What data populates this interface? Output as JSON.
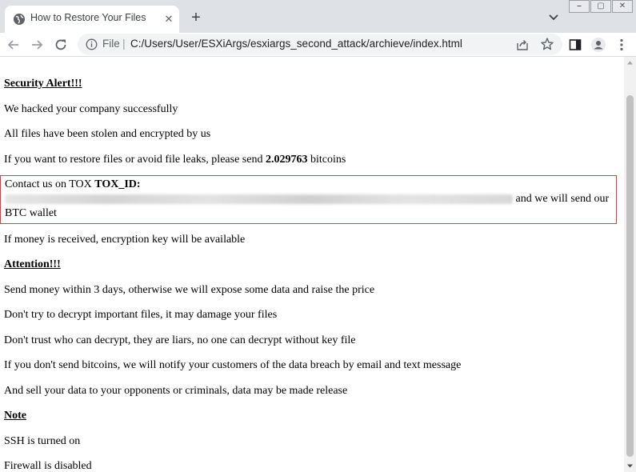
{
  "browser": {
    "tab": {
      "title": "How to Restore Your Files",
      "close_glyph": "✕",
      "favicon": "globe-icon"
    },
    "new_tab_glyph": "+",
    "window_controls": [
      "⎯",
      "▢",
      "✕"
    ],
    "address_bar": {
      "scheme_label": "File",
      "separator": "|",
      "path": "C:/Users/User/ESXiArgs/esxiargs_second_attack/archieve/index.html"
    }
  },
  "page": {
    "security_alert": "Security Alert!!!",
    "line_hacked": "We hacked your company successfully",
    "line_stolen": "All files have been stolen and encrypted by us",
    "restore": {
      "prefix": "If you want to restore files or avoid file leaks, please send ",
      "amount": "2.029763",
      "suffix": " bitcoins"
    },
    "contact": {
      "prefix": "Contact us on TOX ",
      "tox_label": "TOX_ID:",
      "suffix": " and we will send our BTC wallet"
    },
    "line_money": "If money is received, encryption key will be available",
    "attention": "Attention!!!",
    "line_3days": "Send money within 3 days, otherwise we will expose some data and raise the price",
    "line_decrypt": "Don't try to decrypt important files, it may damage your files",
    "line_trust": "Don't trust who can decrypt, they are liars, no one can decrypt without key file",
    "line_notify": "If you don't send bitcoins, we will notify your customers of the data breach by email and text message",
    "line_sell": "And sell your data to your opponents or criminals, data may be made release",
    "note": "Note",
    "line_ssh": "SSH is turned on",
    "line_firewall": "Firewall is disabled"
  },
  "colors": {
    "highlight_border": "#e03c3c",
    "tabstrip": "#dee1e6",
    "omnibox": "#f1f3f4"
  }
}
